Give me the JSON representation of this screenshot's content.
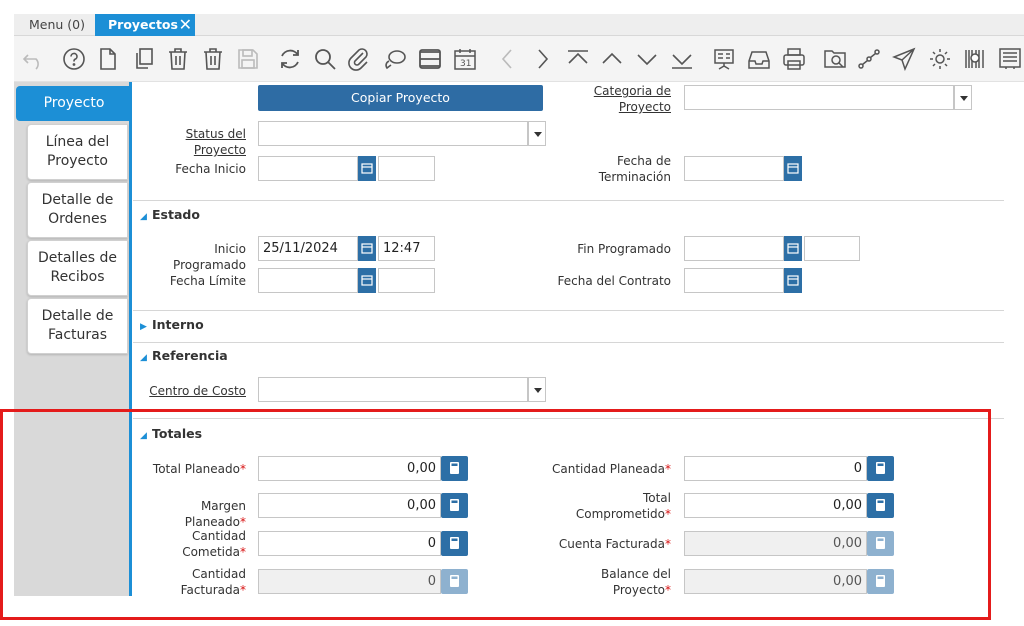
{
  "tabs": [
    {
      "label": "Menu (0)"
    },
    {
      "label": "Proyectos",
      "close": "✕"
    }
  ],
  "toolbar_icons": [
    "undo-icon",
    "help-icon",
    "new-record-icon",
    "copy-icon",
    "delete-icon",
    "delete-selection-icon",
    "save-icon",
    "refresh-icon",
    "find-icon",
    "attachment-icon",
    "chat-icon",
    "grid-toggle-icon",
    "calendar-icon",
    "previous-icon",
    "next-icon",
    "first-record-icon",
    "parent-record-icon",
    "detail-record-icon",
    "last-record-icon",
    "report-icon",
    "archive-icon",
    "print-icon",
    "zoom-across-icon",
    "workflow-icon",
    "send-icon",
    "process-icon",
    "product-info-icon",
    "document-icon"
  ],
  "sidebar": {
    "active": "Proyecto",
    "items": [
      {
        "line1": "Línea del",
        "line2": "Proyecto"
      },
      {
        "line1": "Detalle de",
        "line2": "Ordenes"
      },
      {
        "line1": "Detalles de",
        "line2": "Recibos"
      },
      {
        "line1": "Detalle de",
        "line2": "Facturas"
      }
    ]
  },
  "header": {
    "copy_button": "Copiar Proyecto",
    "categoria_l1": "Categoria de",
    "categoria_l2": "Proyecto",
    "categoria_value": "",
    "status_label": "Status del Proyecto",
    "status_value": "",
    "fecha_inicio_label": "Fecha Inicio",
    "fecha_inicio_value": "",
    "fecha_inicio_time": "",
    "fecha_term_l1": "Fecha de",
    "fecha_term_l2": "Terminación",
    "fecha_term_value": ""
  },
  "estado": {
    "title": "Estado",
    "inicio_prog_label": "Inicio Programado",
    "inicio_prog_date": "25/11/2024",
    "inicio_prog_time": "12:47",
    "fin_prog_label": "Fin Programado",
    "fin_prog_date": "",
    "fin_prog_time": "",
    "fecha_limite_label": "Fecha Límite",
    "fecha_limite_date": "",
    "fecha_limite_time": "",
    "fecha_contrato_label": "Fecha del Contrato",
    "fecha_contrato_date": ""
  },
  "interno": {
    "title": "Interno"
  },
  "referencia": {
    "title": "Referencia",
    "centro_label": "Centro de Costo",
    "centro_value": ""
  },
  "totales": {
    "title": "Totales",
    "required_mark": "*",
    "total_planeado_label": "Total Planeado",
    "total_planeado_value": "0,00",
    "cantidad_planeada_label": "Cantidad Planeada",
    "cantidad_planeada_value": "0",
    "margen_planeado_label": "Margen Planeado",
    "margen_planeado_value": "0,00",
    "total_comprometido_l1": "Total",
    "total_comprometido_l2": "Comprometido",
    "total_comprometido_value": "0,00",
    "cantidad_cometida_l1": "Cantidad",
    "cantidad_cometida_l2": "Cometida",
    "cantidad_cometida_value": "0",
    "cuenta_facturada_label": "Cuenta Facturada",
    "cuenta_facturada_value": "0,00",
    "cantidad_facturada_l1": "Cantidad",
    "cantidad_facturada_l2": "Facturada",
    "cantidad_facturada_value": "0",
    "balance_l1": "Balance del",
    "balance_l2": "Proyecto",
    "balance_value": "0,00"
  },
  "colors": {
    "accent": "#1c8fd6",
    "button": "#2e6ca4",
    "highlight": "#e41b1b"
  }
}
